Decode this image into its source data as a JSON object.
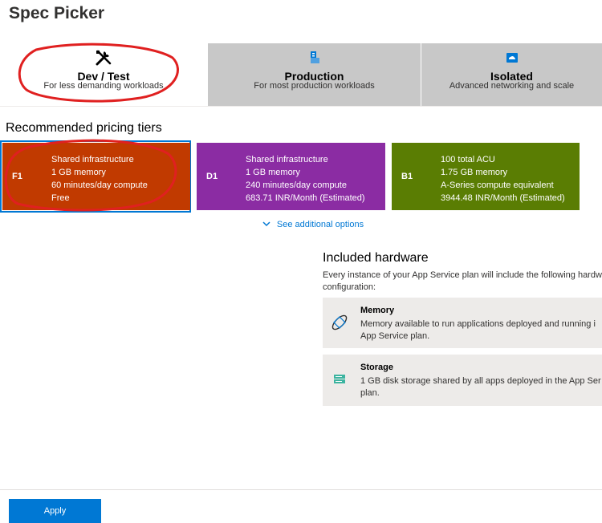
{
  "title": "Spec Picker",
  "tabs": [
    {
      "name": "Dev / Test",
      "desc": "For less demanding workloads",
      "icon": "tools-icon"
    },
    {
      "name": "Production",
      "desc": "For most production workloads",
      "icon": "server-icon"
    },
    {
      "name": "Isolated",
      "desc": "Advanced networking and scale",
      "icon": "cloud-icon"
    }
  ],
  "recommended": {
    "title": "Recommended pricing tiers",
    "tiers": [
      {
        "code": "F1",
        "lines": [
          "Shared infrastructure",
          "1 GB memory",
          "60 minutes/day compute",
          "Free"
        ],
        "color": "#c13a00"
      },
      {
        "code": "D1",
        "lines": [
          "Shared infrastructure",
          "1 GB memory",
          "240 minutes/day compute",
          "683.71 INR/Month (Estimated)"
        ],
        "color": "#8b2ca3"
      },
      {
        "code": "B1",
        "lines": [
          "100 total ACU",
          "1.75 GB memory",
          "A-Series compute equivalent",
          "3944.48 INR/Month (Estimated)"
        ],
        "color": "#5a7d03"
      }
    ],
    "see_more": "See additional options"
  },
  "hardware": {
    "title": "Included hardware",
    "desc_line1": "Every instance of your App Service plan will include the following hardw",
    "desc_line2": "configuration:",
    "items": [
      {
        "name": "Memory",
        "line1": "Memory available to run applications deployed and running i",
        "line2": "App Service plan.",
        "icon": "memory-icon"
      },
      {
        "name": "Storage",
        "line1": "1 GB disk storage shared by all apps deployed in the App Ser",
        "line2": "plan.",
        "icon": "storage-icon"
      }
    ]
  },
  "footer": {
    "apply_label": "Apply"
  },
  "colors": {
    "accent": "#0078d4",
    "annotation": "#e02020"
  }
}
